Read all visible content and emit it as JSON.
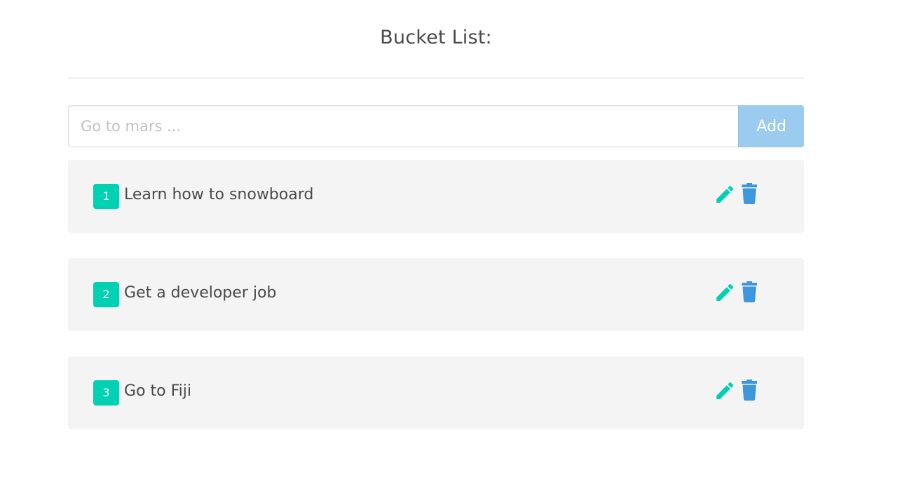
{
  "header": {
    "title": "Bucket List:"
  },
  "form": {
    "input_value": "",
    "input_placeholder": "Go to mars ...",
    "add_label": "Add"
  },
  "items": [
    {
      "number": "1",
      "text": "Learn how to snowboard"
    },
    {
      "number": "2",
      "text": "Get a developer job"
    },
    {
      "number": "3",
      "text": "Go to Fiji"
    }
  ],
  "icons": {
    "edit": "pencil-icon",
    "delete": "trash-icon"
  },
  "colors": {
    "badge": "#00d1b2",
    "edit_icon": "#00d1b2",
    "delete_icon": "#3e96dd",
    "add_button": "#9bccf0",
    "item_background": "#f4f4f4"
  }
}
